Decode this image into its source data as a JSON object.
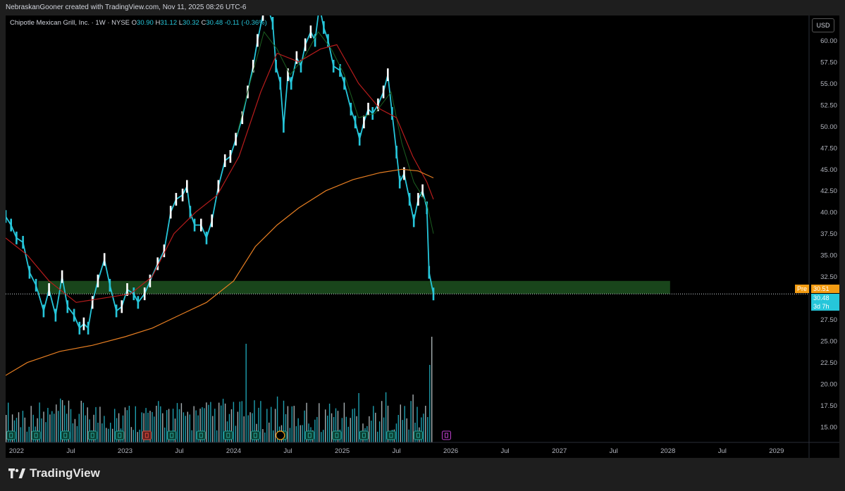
{
  "header": {
    "credit": "NebraskanGooner created with TradingView.com, Nov 11, 2025 08:26 UTC-6"
  },
  "legend": {
    "symbol": "Chipotle Mexican Grill, Inc. · 1W · NYSE",
    "open_k": "O",
    "open": "30.90",
    "high_k": "H",
    "high": "31.12",
    "low_k": "L",
    "low": "30.32",
    "close_k": "C",
    "close": "30.48",
    "change": "-0.11 (-0.36%)"
  },
  "currency_button": "USD",
  "price_tags": {
    "pre_label": "Pre",
    "pre_value": "30.51",
    "last_value": "30.48",
    "countdown": "3d 7h"
  },
  "brand": {
    "name": "TradingView",
    "logo_icon": "tradingview-logo-icon"
  },
  "colors": {
    "background": "#000000",
    "up": "#ffffff",
    "down": "#26c6da",
    "ma_short": "#1b5e20",
    "ma_mid": "#b71c1c",
    "ma_long": "#e67e22",
    "support_zone": "#2e7d32",
    "earnings_badge": "#0b3b2e",
    "pre_tag": "#f39c12"
  },
  "chart_data": {
    "type": "line",
    "title": "Chipotle Mexican Grill, Inc. · 1W · NYSE",
    "x_ticks": [
      "2022",
      "Jul",
      "2023",
      "Jul",
      "2024",
      "Jul",
      "2025",
      "Jul",
      "2026",
      "Jul",
      "2027",
      "Jul",
      "2028",
      "Jul",
      "2029"
    ],
    "y_ticks": [
      15.0,
      17.5,
      20.0,
      22.5,
      25.0,
      27.5,
      30.0,
      32.5,
      35.0,
      37.5,
      40.0,
      42.5,
      45.0,
      47.5,
      50.0,
      52.5,
      55.0,
      57.5,
      60.0
    ],
    "ylim": [
      13.2,
      62.9
    ],
    "x_range": [
      2021.9,
      2029.3
    ],
    "support_zone": [
      30.5,
      32.0
    ],
    "last_price": 30.48,
    "pre_price": 30.51,
    "series": [
      {
        "name": "",
        "kind": "price",
        "points": [
          [
            2021.9,
            39.5
          ],
          [
            2021.95,
            38.5
          ],
          [
            2022.0,
            37.0
          ],
          [
            2022.06,
            36.5
          ],
          [
            2022.12,
            33.0
          ],
          [
            2022.18,
            31.5
          ],
          [
            2022.25,
            28.5
          ],
          [
            2022.3,
            31.0
          ],
          [
            2022.36,
            28.0
          ],
          [
            2022.42,
            32.5
          ],
          [
            2022.47,
            29.0
          ],
          [
            2022.53,
            28.0
          ],
          [
            2022.58,
            26.5
          ],
          [
            2022.62,
            27.0
          ],
          [
            2022.66,
            26.5
          ],
          [
            2022.7,
            29.5
          ],
          [
            2022.75,
            32.0
          ],
          [
            2022.81,
            34.5
          ],
          [
            2022.86,
            31.5
          ],
          [
            2022.92,
            28.5
          ],
          [
            2022.97,
            29.0
          ],
          [
            2023.02,
            31.0
          ],
          [
            2023.08,
            30.5
          ],
          [
            2023.12,
            29.5
          ],
          [
            2023.18,
            30.5
          ],
          [
            2023.23,
            32.0
          ],
          [
            2023.3,
            34.0
          ],
          [
            2023.36,
            35.5
          ],
          [
            2023.42,
            40.0
          ],
          [
            2023.47,
            41.5
          ],
          [
            2023.53,
            42.0
          ],
          [
            2023.57,
            43.0
          ],
          [
            2023.6,
            40.0
          ],
          [
            2023.64,
            38.5
          ],
          [
            2023.7,
            38.5
          ],
          [
            2023.75,
            37.0
          ],
          [
            2023.8,
            39.0
          ],
          [
            2023.86,
            43.0
          ],
          [
            2023.92,
            46.0
          ],
          [
            2023.97,
            46.5
          ],
          [
            2024.02,
            48.5
          ],
          [
            2024.08,
            51.0
          ],
          [
            2024.13,
            54.0
          ],
          [
            2024.18,
            57.0
          ],
          [
            2024.22,
            60.0
          ],
          [
            2024.27,
            63.0
          ],
          [
            2024.31,
            64.0
          ],
          [
            2024.36,
            62.0
          ],
          [
            2024.39,
            57.0
          ],
          [
            2024.43,
            55.0
          ],
          [
            2024.46,
            50.0
          ],
          [
            2024.5,
            56.0
          ],
          [
            2024.53,
            55.0
          ],
          [
            2024.58,
            58.0
          ],
          [
            2024.62,
            57.0
          ],
          [
            2024.66,
            59.5
          ],
          [
            2024.71,
            61.0
          ],
          [
            2024.75,
            60.0
          ],
          [
            2024.79,
            64.0
          ],
          [
            2024.83,
            61.5
          ],
          [
            2024.87,
            60.0
          ],
          [
            2024.92,
            57.0
          ],
          [
            2024.98,
            56.5
          ],
          [
            2025.02,
            55.0
          ],
          [
            2025.08,
            52.0
          ],
          [
            2025.12,
            50.5
          ],
          [
            2025.16,
            48.5
          ],
          [
            2025.2,
            50.5
          ],
          [
            2025.24,
            52.0
          ],
          [
            2025.28,
            51.5
          ],
          [
            2025.33,
            52.5
          ],
          [
            2025.38,
            54.0
          ],
          [
            2025.42,
            56.0
          ],
          [
            2025.46,
            51.5
          ],
          [
            2025.5,
            47.0
          ],
          [
            2025.53,
            43.5
          ],
          [
            2025.57,
            44.5
          ],
          [
            2025.62,
            41.5
          ],
          [
            2025.66,
            39.0
          ],
          [
            2025.7,
            41.5
          ],
          [
            2025.74,
            42.5
          ],
          [
            2025.78,
            40.5
          ],
          [
            2025.8,
            33.0
          ],
          [
            2025.84,
            30.48
          ]
        ]
      },
      {
        "name": "",
        "kind": "ma_short",
        "points": [
          [
            2024.03,
            49.0
          ],
          [
            2024.15,
            55.0
          ],
          [
            2024.28,
            61.0
          ],
          [
            2024.4,
            59.0
          ],
          [
            2024.52,
            56.0
          ],
          [
            2024.65,
            58.0
          ],
          [
            2024.78,
            61.0
          ],
          [
            2024.9,
            59.0
          ],
          [
            2025.02,
            56.0
          ],
          [
            2025.15,
            51.0
          ],
          [
            2025.3,
            51.5
          ],
          [
            2025.45,
            54.0
          ],
          [
            2025.55,
            48.0
          ],
          [
            2025.66,
            43.5
          ],
          [
            2025.78,
            41.0
          ],
          [
            2025.84,
            37.5
          ]
        ]
      },
      {
        "name": "",
        "kind": "ma_mid",
        "points": [
          [
            2021.9,
            37.0
          ],
          [
            2022.1,
            35.0
          ],
          [
            2022.3,
            32.0
          ],
          [
            2022.55,
            29.5
          ],
          [
            2022.8,
            30.0
          ],
          [
            2023.05,
            30.5
          ],
          [
            2023.25,
            32.5
          ],
          [
            2023.45,
            37.5
          ],
          [
            2023.65,
            40.0
          ],
          [
            2023.85,
            42.0
          ],
          [
            2024.05,
            46.5
          ],
          [
            2024.25,
            54.0
          ],
          [
            2024.4,
            58.5
          ],
          [
            2024.6,
            57.5
          ],
          [
            2024.8,
            59.0
          ],
          [
            2024.95,
            59.5
          ],
          [
            2025.15,
            55.0
          ],
          [
            2025.35,
            52.0
          ],
          [
            2025.5,
            51.0
          ],
          [
            2025.65,
            46.5
          ],
          [
            2025.78,
            43.5
          ],
          [
            2025.84,
            41.5
          ]
        ]
      },
      {
        "name": "",
        "kind": "ma_long",
        "points": [
          [
            2021.9,
            21.0
          ],
          [
            2022.1,
            22.5
          ],
          [
            2022.4,
            23.8
          ],
          [
            2022.7,
            24.5
          ],
          [
            2023.0,
            25.5
          ],
          [
            2023.25,
            26.5
          ],
          [
            2023.5,
            28.0
          ],
          [
            2023.75,
            29.5
          ],
          [
            2024.0,
            32.0
          ],
          [
            2024.2,
            36.0
          ],
          [
            2024.4,
            38.5
          ],
          [
            2024.6,
            40.5
          ],
          [
            2024.85,
            42.5
          ],
          [
            2025.1,
            43.8
          ],
          [
            2025.35,
            44.6
          ],
          [
            2025.55,
            45.0
          ],
          [
            2025.7,
            44.8
          ],
          [
            2025.84,
            44.0
          ]
        ]
      }
    ]
  }
}
